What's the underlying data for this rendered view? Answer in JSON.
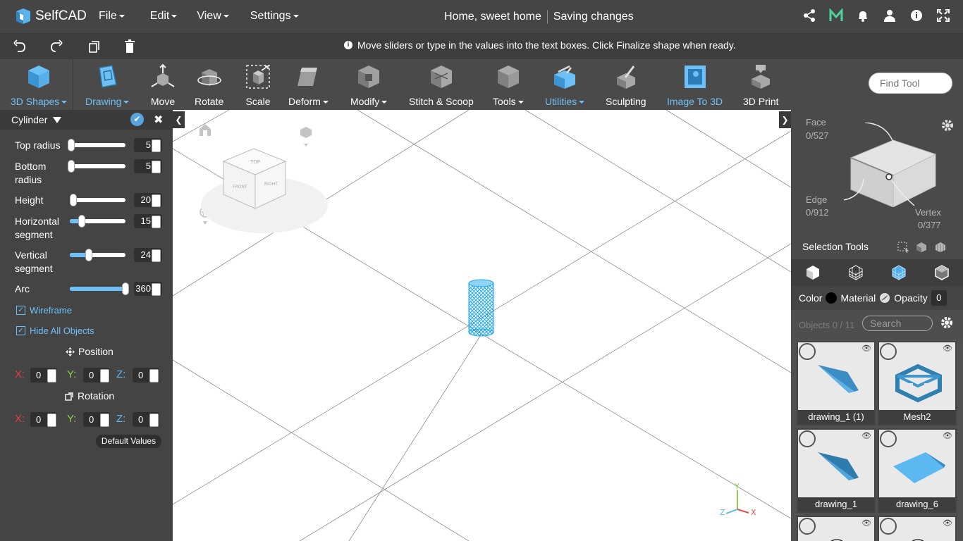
{
  "app": {
    "name": "SelfCAD",
    "doc_title": "Home, sweet home",
    "save_status": "Saving changes"
  },
  "menu": {
    "file": "File",
    "edit": "Edit",
    "view": "View",
    "settings": "Settings"
  },
  "hint": "Move sliders or type in the values into the text boxes. Click Finalize shape when ready.",
  "toolbar": {
    "items": [
      "3D Shapes",
      "Drawing",
      "Move",
      "Rotate",
      "Scale",
      "Deform",
      "Modify",
      "Stitch & Scoop",
      "Tools",
      "Utilities",
      "Sculpting",
      "Image To 3D",
      "3D Print"
    ],
    "find_placeholder": "Find Tool",
    "accent": "#6cc0f5"
  },
  "panel": {
    "title": "Cylinder",
    "fields": [
      {
        "label": "Top radius",
        "value": "5",
        "level": 0.02
      },
      {
        "label": "Bottom radius",
        "value": "5",
        "level": 0.02
      },
      {
        "label": "Height",
        "value": "20",
        "level": 0.06
      },
      {
        "label": "Horizontal segment",
        "value": "15",
        "level": 0.22
      },
      {
        "label": "Vertical segment",
        "value": "24",
        "level": 0.34
      },
      {
        "label": "Arc",
        "value": "360",
        "level": 1.0
      }
    ],
    "wireframe": "Wireframe",
    "hide_all": "Hide All Objects",
    "position_label": "Position",
    "rotation_label": "Rotation",
    "position": {
      "x": "0",
      "y": "0",
      "z": "0"
    },
    "rotation": {
      "x": "0",
      "y": "0",
      "z": "0"
    },
    "axis_labels": {
      "x": "X:",
      "y": "Y:",
      "z": "Z:"
    },
    "axis_colors": {
      "x": "#e04040",
      "y": "#8bd14a",
      "z": "#5bb8f0"
    },
    "default_values": "Default Values"
  },
  "selection": {
    "face_label": "Face",
    "face_count": "0/527",
    "edge_label": "Edge",
    "edge_count": "0/912",
    "vertex_label": "Vertex",
    "vertex_count": "0/377",
    "tools_label": "Selection Tools"
  },
  "props": {
    "color": "Color",
    "material": "Material",
    "opacity": "Opacity",
    "opacity_value": "0"
  },
  "objects": {
    "count": "Objects 0 / 11",
    "search_placeholder": "Search",
    "items": [
      {
        "name": "drawing_1 (1)"
      },
      {
        "name": "Mesh2"
      },
      {
        "name": "drawing_1"
      },
      {
        "name": "drawing_6"
      }
    ]
  },
  "viewcube": {
    "top": "TOP",
    "front": "FRONT",
    "right": "RIGHT"
  },
  "axes": {
    "x": "X",
    "y": "Y",
    "z": "Z"
  }
}
